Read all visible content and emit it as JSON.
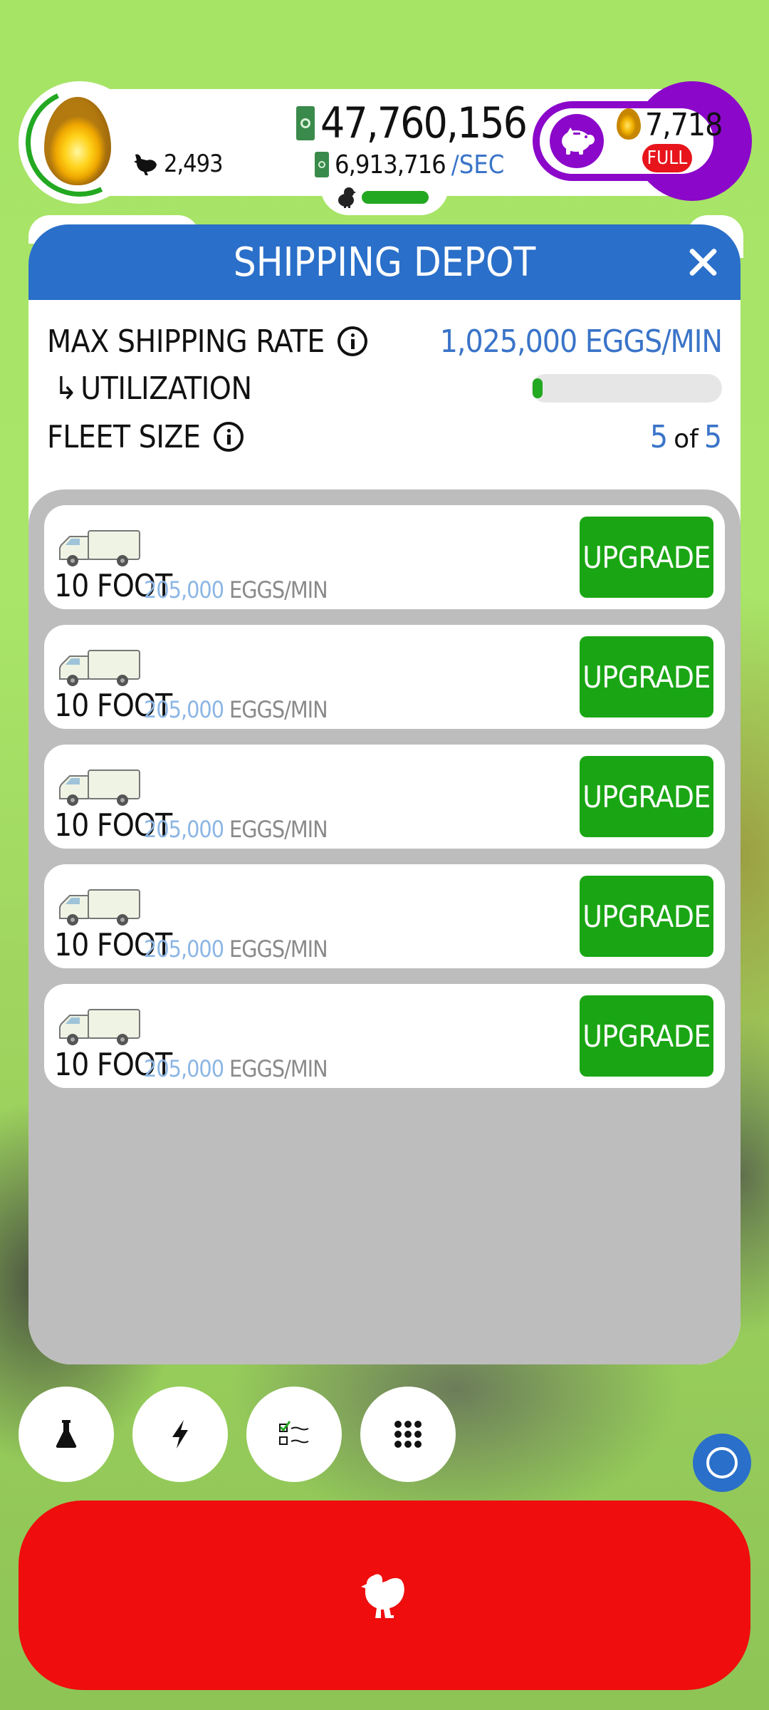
{
  "hud": {
    "chicken_count": "2,493",
    "money": "47,760,156",
    "money_rate": "6,913,716",
    "money_rate_unit": "/SEC",
    "golden_eggs": "7,718",
    "piggy_status": "FULL"
  },
  "panel": {
    "title": "SHIPPING DEPOT",
    "max_shipping_rate_label": "MAX SHIPPING RATE",
    "max_shipping_rate_value": "1,025,000 EGGS/MIN",
    "utilization_arrow": "↳",
    "utilization_label": "UTILIZATION",
    "utilization_fraction": 0.03,
    "fleet_size_label": "FLEET SIZE",
    "fleet_current": "5",
    "fleet_of": "of",
    "fleet_max": "5"
  },
  "trucks": [
    {
      "name": "10 FOOT",
      "rate": "205,000",
      "unit": "EGGS/MIN",
      "button": "UPGRADE"
    },
    {
      "name": "10 FOOT",
      "rate": "205,000",
      "unit": "EGGS/MIN",
      "button": "UPGRADE"
    },
    {
      "name": "10 FOOT",
      "rate": "205,000",
      "unit": "EGGS/MIN",
      "button": "UPGRADE"
    },
    {
      "name": "10 FOOT",
      "rate": "205,000",
      "unit": "EGGS/MIN",
      "button": "UPGRADE"
    },
    {
      "name": "10 FOOT",
      "rate": "205,000",
      "unit": "EGGS/MIN",
      "button": "UPGRADE"
    }
  ],
  "toolbar": {
    "icons": [
      "research-flask-icon",
      "boost-lightning-icon",
      "missions-checklist-icon",
      "menu-grid-icon"
    ]
  },
  "colors": {
    "header_blue": "#2a6fc9",
    "upgrade_green": "#1aa614",
    "piggy_purple": "#8b07c9",
    "hatch_red": "#ef0d0d",
    "value_blue": "#3a74c8"
  }
}
